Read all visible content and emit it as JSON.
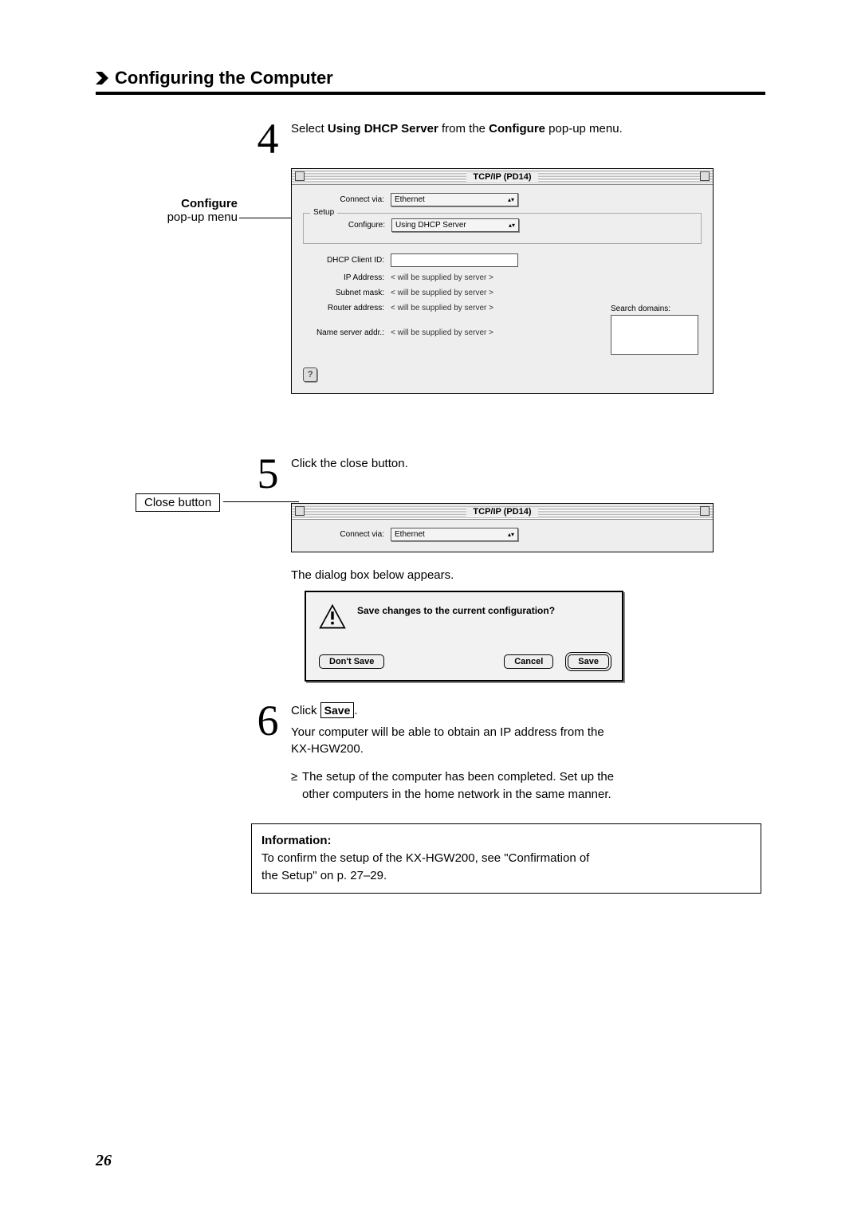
{
  "header": {
    "title": "Configuring the Computer"
  },
  "step4": {
    "num": "4",
    "text_pre": "Select ",
    "text_bold1": "Using DHCP Server",
    "text_mid": " from the ",
    "text_bold2": "Configure",
    "text_post": " pop-up menu."
  },
  "callout_configure": {
    "bold": "Configure",
    "sub": "pop-up menu"
  },
  "tcpip_window": {
    "title": "TCP/IP (PD14)",
    "connect_via_label": "Connect via:",
    "connect_via_value": "Ethernet",
    "setup_legend": "Setup",
    "configure_label": "Configure:",
    "configure_value": "Using DHCP Server",
    "dhcp_client_label": "DHCP Client ID:",
    "ip_label": "IP Address:",
    "subnet_label": "Subnet mask:",
    "router_label": "Router address:",
    "nameserver_label": "Name server addr.:",
    "supplied": "< will be supplied by server >",
    "search_domains": "Search domains:",
    "help": "?"
  },
  "step5": {
    "num": "5",
    "text": "Click the close button."
  },
  "callout_close": "Close button",
  "step5_followup": "The dialog box below appears.",
  "dialog": {
    "msg": "Save changes to the current configuration?",
    "dont_save": "Don't Save",
    "cancel": "Cancel",
    "save": "Save"
  },
  "step6": {
    "num": "6",
    "pre": "Click ",
    "btn": "Save",
    "post": ".",
    "line2a": "Your computer will be able to obtain an IP address from the",
    "line2b": "KX-HGW200."
  },
  "bullet": {
    "mark": "≥",
    "l1": "The setup of the computer has been completed. Set up the",
    "l2": "other computers in the home network in the same manner."
  },
  "info": {
    "heading": "Information:",
    "l1": "To confirm the setup of the KX-HGW200, see \"Confirmation of",
    "l2": "the Setup\" on p. 27–29."
  },
  "page_number": "26"
}
